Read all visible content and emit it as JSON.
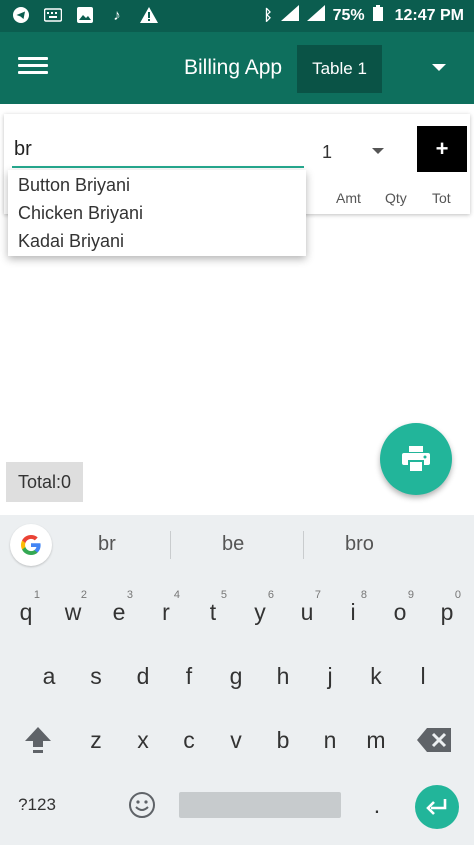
{
  "status_bar": {
    "battery": "75%",
    "time": "12:47 PM",
    "left_icons": [
      "telegram-icon",
      "keyboard-icon",
      "gallery-icon",
      "music-icon",
      "warning-icon"
    ]
  },
  "app_bar": {
    "title": "Billing App",
    "table_selector": "Table 1"
  },
  "order_entry": {
    "item_query": "br",
    "quantity": "1",
    "add_label": "+",
    "columns": [
      "Amt",
      "Qty",
      "Tot"
    ]
  },
  "suggestions_dropdown": [
    "Button Briyani",
    "Chicken Briyani",
    "Kadai Briyani"
  ],
  "total": "Total:0",
  "keyboard": {
    "word_suggestions": [
      "br",
      "be",
      "bro"
    ],
    "row1": [
      {
        "key": "q",
        "hint": "1"
      },
      {
        "key": "w",
        "hint": "2"
      },
      {
        "key": "e",
        "hint": "3"
      },
      {
        "key": "r",
        "hint": "4"
      },
      {
        "key": "t",
        "hint": "5"
      },
      {
        "key": "y",
        "hint": "6"
      },
      {
        "key": "u",
        "hint": "7"
      },
      {
        "key": "i",
        "hint": "8"
      },
      {
        "key": "o",
        "hint": "9"
      },
      {
        "key": "p",
        "hint": "0"
      }
    ],
    "row2": [
      "a",
      "s",
      "d",
      "f",
      "g",
      "h",
      "j",
      "k",
      "l"
    ],
    "row3": [
      "z",
      "x",
      "c",
      "v",
      "b",
      "n",
      "m"
    ],
    "symbols_key": "?123",
    "period_key": "."
  },
  "colors": {
    "status_bar": "#0b5d4f",
    "app_bar": "#0e6f5d",
    "accent": "#22b59a"
  }
}
